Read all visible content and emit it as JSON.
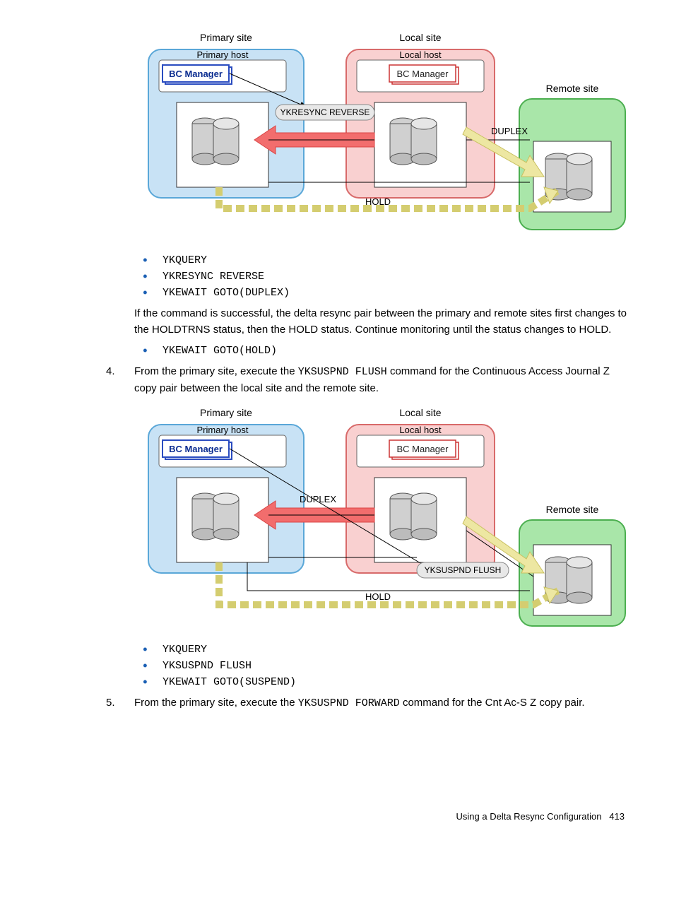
{
  "diagram1": {
    "primarySite": "Primary site",
    "primaryHost": "Primary host",
    "bcManagerPrimary": "BC Manager",
    "localSite": "Local site",
    "localHost": "Local host",
    "bcManagerLocal": "BC Manager",
    "remoteSite": "Remote site",
    "ykresyncReverse": "YKRESYNC REVERSE",
    "duplex": "DUPLEX",
    "hold": "HOLD"
  },
  "bullets1": [
    "YKQUERY",
    "YKRESYNC REVERSE",
    "YKEWAIT GOTO(DUPLEX)"
  ],
  "para1": "If the command is successful, the delta resync pair between the primary and remote sites first changes to the HOLDTRNS status, then the HOLD status. Continue monitoring until the status changes to HOLD.",
  "bullets2": [
    "YKEWAIT GOTO(HOLD)"
  ],
  "step4": {
    "num": "4.",
    "pre": "From the primary site, execute the ",
    "cmd": "YKSUSPND FLUSH",
    "post": " command for the Continuous Access Journal Z copy pair between the local site and the remote site."
  },
  "diagram2": {
    "primarySite": "Primary site",
    "primaryHost": "Primary host",
    "bcManagerPrimary": "BC Manager",
    "localSite": "Local site",
    "localHost": "Local host",
    "bcManagerLocal": "BC Manager",
    "remoteSite": "Remote site",
    "duplex": "DUPLEX",
    "yksuspndFlush": "YKSUSPND FLUSH",
    "hold": "HOLD"
  },
  "bullets3": [
    "YKQUERY",
    "YKSUSPND FLUSH",
    "YKEWAIT GOTO(SUSPEND)"
  ],
  "step5": {
    "num": "5.",
    "pre": "From the primary site, execute the ",
    "cmd": "YKSUSPND FORWARD",
    "post": " command for the Cnt Ac-S Z copy pair."
  },
  "footer": {
    "text": "Using a Delta Resync Configuration",
    "page": "413"
  }
}
